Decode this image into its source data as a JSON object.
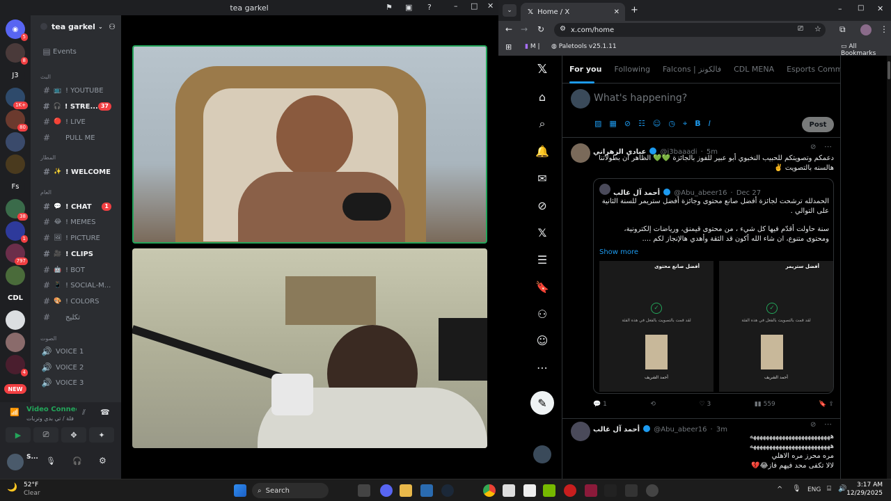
{
  "discord": {
    "window_title": "tea garkel",
    "server_name": "tea garkel",
    "events_label": "Events",
    "server_rail": [
      {
        "label": "",
        "badge": "5"
      },
      {
        "label": "",
        "badge": "8"
      },
      {
        "label": "J3",
        "badge": ""
      },
      {
        "label": "",
        "badge": "1K+"
      },
      {
        "label": "",
        "badge": "80"
      },
      {
        "label": "",
        "badge": ""
      },
      {
        "label": "",
        "badge": ""
      },
      {
        "label": "Fs",
        "badge": ""
      },
      {
        "label": "",
        "badge": "38"
      },
      {
        "label": "",
        "badge": "1"
      },
      {
        "label": "",
        "badge": "797"
      },
      {
        "label": "",
        "badge": ""
      },
      {
        "label": "CDL",
        "badge": ""
      },
      {
        "label": "",
        "badge": ""
      },
      {
        "label": "",
        "badge": ""
      },
      {
        "label": "",
        "badge": "4"
      },
      {
        "label": "NEW",
        "badge": ""
      }
    ],
    "categories": [
      "البث",
      "المطار",
      "العام",
      "الصوت"
    ],
    "channels": [
      {
        "icon": "📺",
        "label": "! YOUTUBE",
        "bold": false,
        "count": ""
      },
      {
        "icon": "🎧",
        "label": "! STRE...",
        "bold": true,
        "count": "37"
      },
      {
        "icon": "🔴",
        "label": "! LIVE",
        "bold": false,
        "count": ""
      },
      {
        "icon": "",
        "label": "PULL ME",
        "bold": false,
        "count": ""
      },
      {
        "icon": "✨",
        "label": "! WELCOME",
        "bold": true,
        "count": ""
      },
      {
        "icon": "💬",
        "label": "! CHAT",
        "bold": true,
        "count": "1"
      },
      {
        "icon": "😂",
        "label": "! MEMES",
        "bold": false,
        "count": ""
      },
      {
        "icon": "🖼",
        "label": "! PICTURE",
        "bold": false,
        "count": ""
      },
      {
        "icon": "🎥",
        "label": "! CLIPS",
        "bold": true,
        "count": ""
      },
      {
        "icon": "🤖",
        "label": "! BOT",
        "bold": false,
        "count": ""
      },
      {
        "icon": "📱",
        "label": "! SOCIAL-M...",
        "bold": false,
        "count": ""
      },
      {
        "icon": "🎨",
        "label": "! COLORS",
        "bold": false,
        "count": ""
      },
      {
        "icon": "",
        "label": "تكليج",
        "bold": false,
        "count": ""
      }
    ],
    "voice_channels": [
      {
        "label": "VOICE 1"
      },
      {
        "label": "VOICE 2"
      },
      {
        "label": "VOICE 3"
      }
    ],
    "voice_panel": {
      "status": "Video Connecte",
      "channel": "فلة / تي بدي وتربات"
    },
    "user_panel": {
      "username": "S..."
    }
  },
  "browser": {
    "tab_title": "Home / X",
    "url": "x.com/home",
    "bookmarks": [
      {
        "label": "M |"
      },
      {
        "label": "Paletools v25.1.11"
      }
    ],
    "all_bookmarks": "All Bookmarks"
  },
  "x": {
    "tabs": [
      "For you",
      "Following",
      "Falcons | فالكونز",
      "CDL MENA",
      "Esports Community"
    ],
    "composer_placeholder": "What's happening?",
    "post_button": "Post",
    "tweets": [
      {
        "name": "عبادي الزهراني",
        "handle": "@i3baaadi",
        "time": "5m",
        "text": "دعمكم وتصويتكم للحبيب النخبوي أبو عبير للفوز بالجائزة 💚💚 الظاهر ان بطولاتنا هالسنه بالتصويت ✌️",
        "quote": {
          "name": "أحمد آل غالب",
          "handle": "@Abu_abeer16",
          "time": "Dec 27",
          "text1": "الحمدلله ترشحت لجائزة أفضل صانع محتوى وجائزة أفضل ستريمر للسنة الثانية على التوالي .",
          "text2": "سنة حاولت أقدّم فيها كل شيء ، من محتوى قيمنق، ورياضات إلكترونية، ومحتوى متنوع، ان شاء الله أكون قد الثقة وأهدي هالإنجاز لكم ....",
          "show_more": "Show more",
          "cards": [
            {
              "title": "أفضل صانع محتوى",
              "voted": "لقد قمت بالتصويت بالفعل في هذه الفئة",
              "nominee": "أحمد الشريف"
            },
            {
              "title": "أفضل ستريمر",
              "voted": "لقد قمت بالتصويت بالفعل في هذه الفئة",
              "nominee": "أحمد الشريف"
            }
          ]
        },
        "replies": "1",
        "likes": "3",
        "views": "559"
      },
      {
        "name": "أحمد آل غالب",
        "handle": "@Abu_abeer16",
        "time": "3m",
        "lines": [
          "هههههههههههههههههههههههههه",
          "هههههههههههههههههههههههههه",
          "مره محرز مره الاهلي",
          "لالا تكفى محد فيهم فاز😂💔"
        ]
      }
    ]
  },
  "taskbar": {
    "weather_temp": "52°F",
    "weather_desc": "Clear",
    "search_label": "Search",
    "lang": "ENG",
    "time": "3:17 AM",
    "date": "12/29/2025"
  },
  "colors": {
    "discord_bg": "#1e1f22",
    "discord_sidebar": "#2b2d31",
    "x_accent": "#1d9bf0",
    "green": "#23a55a",
    "red": "#f23f42"
  }
}
